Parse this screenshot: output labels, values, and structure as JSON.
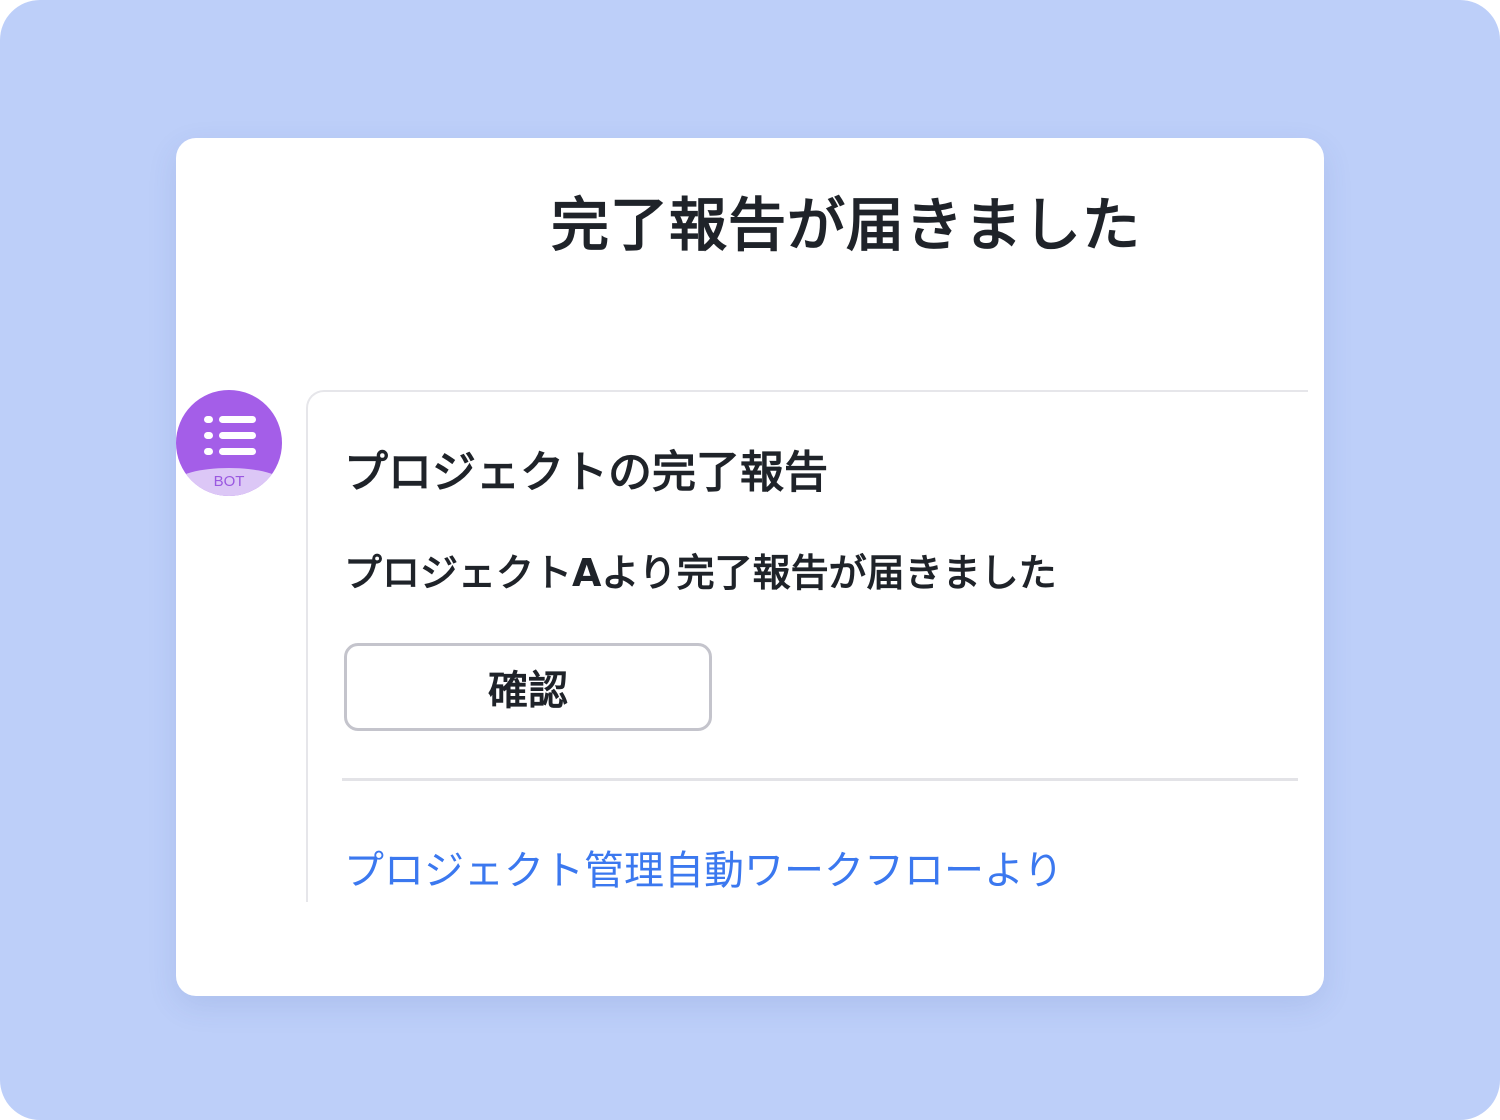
{
  "card": {
    "title": "完了報告が届きました"
  },
  "avatar": {
    "icon": "list-icon",
    "badge": "BOT"
  },
  "message": {
    "heading": "プロジェクトの完了報告",
    "body": "プロジェクトAより完了報告が届きました",
    "confirm_label": "確認",
    "footer_link": "プロジェクト管理自動ワークフローより"
  },
  "colors": {
    "background": "#bdcff9",
    "avatar": "#a45ee8",
    "avatar_badge": "#dcc7f6",
    "link": "#3b78ef",
    "text": "#1f2329"
  }
}
